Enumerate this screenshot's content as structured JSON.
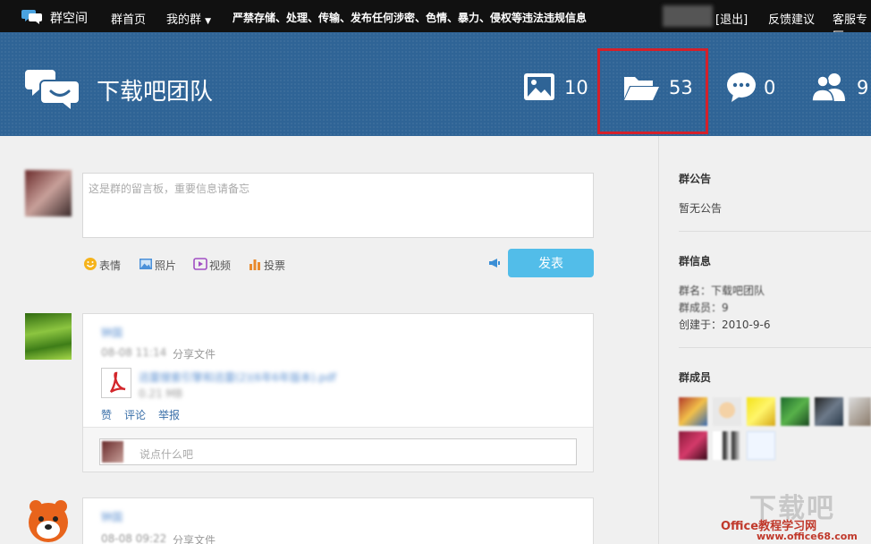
{
  "topbar": {
    "brand": "群空间",
    "nav_home": "群首页",
    "nav_mygroups": "我的群",
    "warning": "严禁存储、处理、传输、发布任何涉密、色情、暴力、侵权等违法违规信息",
    "logout": "[退出]",
    "feedback": "反馈建议",
    "service": "客服专区"
  },
  "banner": {
    "group_name": "下载吧团队",
    "stats": {
      "photos": "10",
      "files": "53",
      "comments": "0",
      "members": "9"
    }
  },
  "composer": {
    "placeholder": "这是群的留言板，重要信息请备忘",
    "tools": [
      "表情",
      "照片",
      "视频",
      "投票"
    ],
    "submit": "发表"
  },
  "feed": [
    {
      "user": "钟国",
      "time": "08-08 11:14",
      "action": "分享文件",
      "file_name": "迅雷搜索引擎和迅雷(2)(6年6年版本).pdf",
      "file_size": "0.21 MB",
      "actions": [
        "赞",
        "评论",
        "举报"
      ],
      "comment_placeholder": "说点什么吧"
    },
    {
      "user": "钟国",
      "time": "08-08 09:22",
      "action": "分享文件"
    }
  ],
  "sidebar": {
    "notice_title": "群公告",
    "notice_text": "暂无公告",
    "info_title": "群信息",
    "info_name": "群名：下载吧团队",
    "info_members": "群成员：9",
    "info_created": "创建于：2010-9-6",
    "members_title": "群成员"
  },
  "watermark": {
    "big": "下载吧",
    "small": "Office教程学习网",
    "url": "www.office68.com"
  },
  "colors": {
    "banner": "#2f6496",
    "accent": "#52bde9",
    "highlight": "#d4202a"
  }
}
